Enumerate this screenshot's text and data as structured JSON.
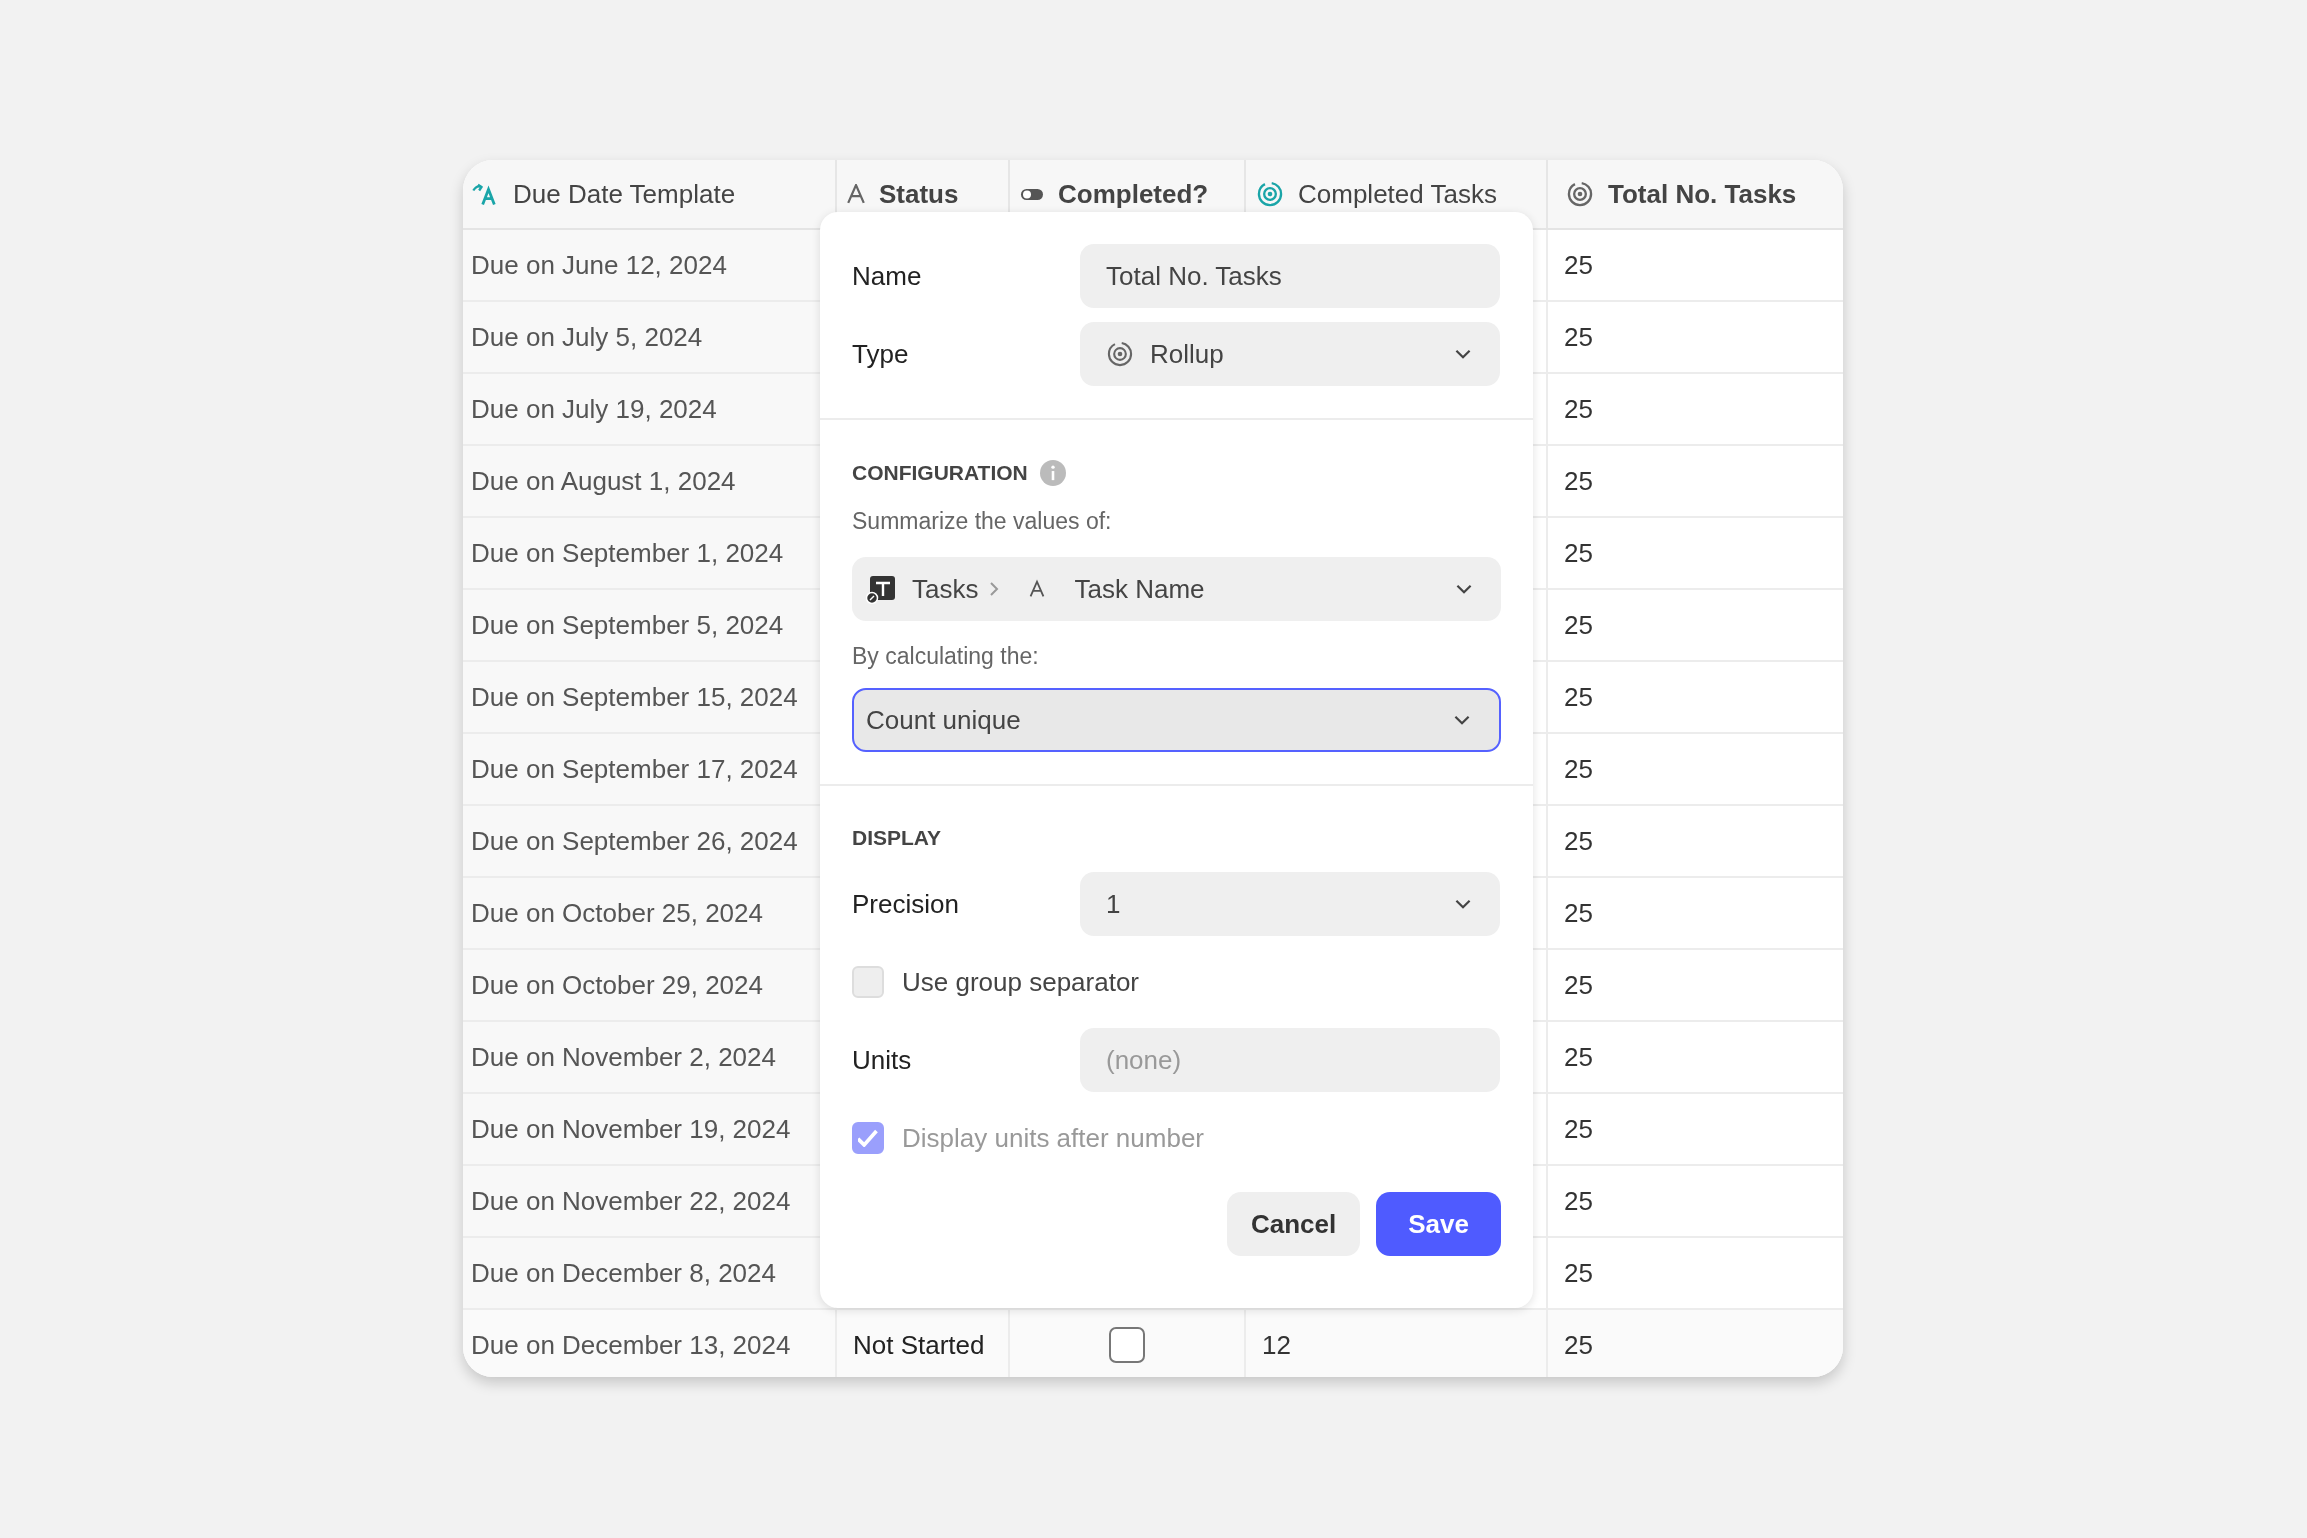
{
  "table": {
    "columns": [
      {
        "label": "Due Date Template",
        "kind": "formula",
        "emphasized": false
      },
      {
        "label": "Status",
        "kind": "text",
        "emphasized": true
      },
      {
        "label": "Completed?",
        "kind": "toggle",
        "emphasized": true
      },
      {
        "label": "Completed Tasks",
        "kind": "formula-rollup",
        "emphasized": false
      },
      {
        "label": "Total No. Tasks",
        "kind": "rollup",
        "emphasized": true
      }
    ],
    "rows": [
      {
        "due": "Due on June 12, 2024",
        "total": "25"
      },
      {
        "due": "Due on July 5, 2024",
        "total": "25"
      },
      {
        "due": "Due on July 19, 2024",
        "total": "25"
      },
      {
        "due": "Due on August 1, 2024",
        "total": "25"
      },
      {
        "due": "Due on September 1, 2024",
        "total": "25"
      },
      {
        "due": "Due on September 5, 2024",
        "total": "25"
      },
      {
        "due": "Due on September 15, 2024",
        "total": "25"
      },
      {
        "due": "Due on September 17, 2024",
        "total": "25"
      },
      {
        "due": "Due on September 26, 2024",
        "total": "25"
      },
      {
        "due": "Due on October 25, 2024",
        "total": "25"
      },
      {
        "due": "Due on October 29, 2024",
        "total": "25"
      },
      {
        "due": "Due on November 2, 2024",
        "total": "25"
      },
      {
        "due": "Due on November 19, 2024",
        "total": "25"
      },
      {
        "due": "Due on November 22, 2024",
        "total": "25"
      },
      {
        "due": "Due on December 8, 2024",
        "total": "25"
      },
      {
        "due": "Due on December 13, 2024",
        "status": "Not Started",
        "completed": false,
        "completed_tasks": "12",
        "total": "25"
      }
    ]
  },
  "field_editor": {
    "name": {
      "label": "Name",
      "value": "Total No. Tasks"
    },
    "type": {
      "label": "Type",
      "value": "Rollup"
    },
    "configuration": {
      "heading": "CONFIGURATION",
      "summarize_label": "Summarize the values of:",
      "source_table": "Tasks",
      "source_field": "Task Name",
      "calc_label": "By calculating the:",
      "calculation": "Count unique",
      "calculation_focused": true
    },
    "display": {
      "heading": "DISPLAY",
      "precision": {
        "label": "Precision",
        "value": "1"
      },
      "group_separator": {
        "label": "Use group separator",
        "checked": false
      },
      "units": {
        "label": "Units",
        "placeholder": "(none)"
      },
      "units_after": {
        "label": "Display units after number",
        "checked": true,
        "disabled": true
      }
    },
    "buttons": [
      {
        "label": "Cancel",
        "kind": "secondary"
      },
      {
        "label": "Save",
        "kind": "primary"
      }
    ]
  }
}
